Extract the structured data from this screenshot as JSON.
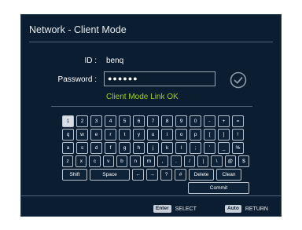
{
  "window": {
    "title": "Network - Client Mode"
  },
  "form": {
    "id_label": "ID :",
    "id_value": "benq",
    "password_label": "Password :",
    "password_value": "●●●●●●",
    "status": "Client Mode Link OK",
    "status_color": "#9fd11b"
  },
  "keyboard": {
    "rows": [
      [
        "1",
        "2",
        "3",
        "4",
        "5",
        "6",
        "7",
        "8",
        "9",
        "0",
        "-",
        "+",
        "="
      ],
      [
        "q",
        "w",
        "e",
        "r",
        "t",
        "y",
        "u",
        "i",
        "o",
        "p",
        "[",
        "]",
        "!"
      ],
      [
        "a",
        "s",
        "d",
        "f",
        "g",
        "h",
        "j",
        "k",
        "l",
        ";",
        "'",
        "_",
        "%"
      ],
      [
        "z",
        "x",
        "c",
        "v",
        "b",
        "n",
        "m",
        ",",
        ".",
        "/",
        "|",
        "\\",
        "@",
        "$"
      ]
    ],
    "selected_key": "1",
    "shift_label": "Shift",
    "space_label": "Space",
    "left_arrow": "←",
    "right_arrow": "→",
    "question_key": "?",
    "hash_key": "#",
    "delete_label": "Delete",
    "clean_label": "Clean",
    "commit_label": "Commit"
  },
  "footer": {
    "enter_button": "Enter",
    "enter_action": "SELECT",
    "auto_button": "Auto",
    "auto_action": "RETURN"
  }
}
